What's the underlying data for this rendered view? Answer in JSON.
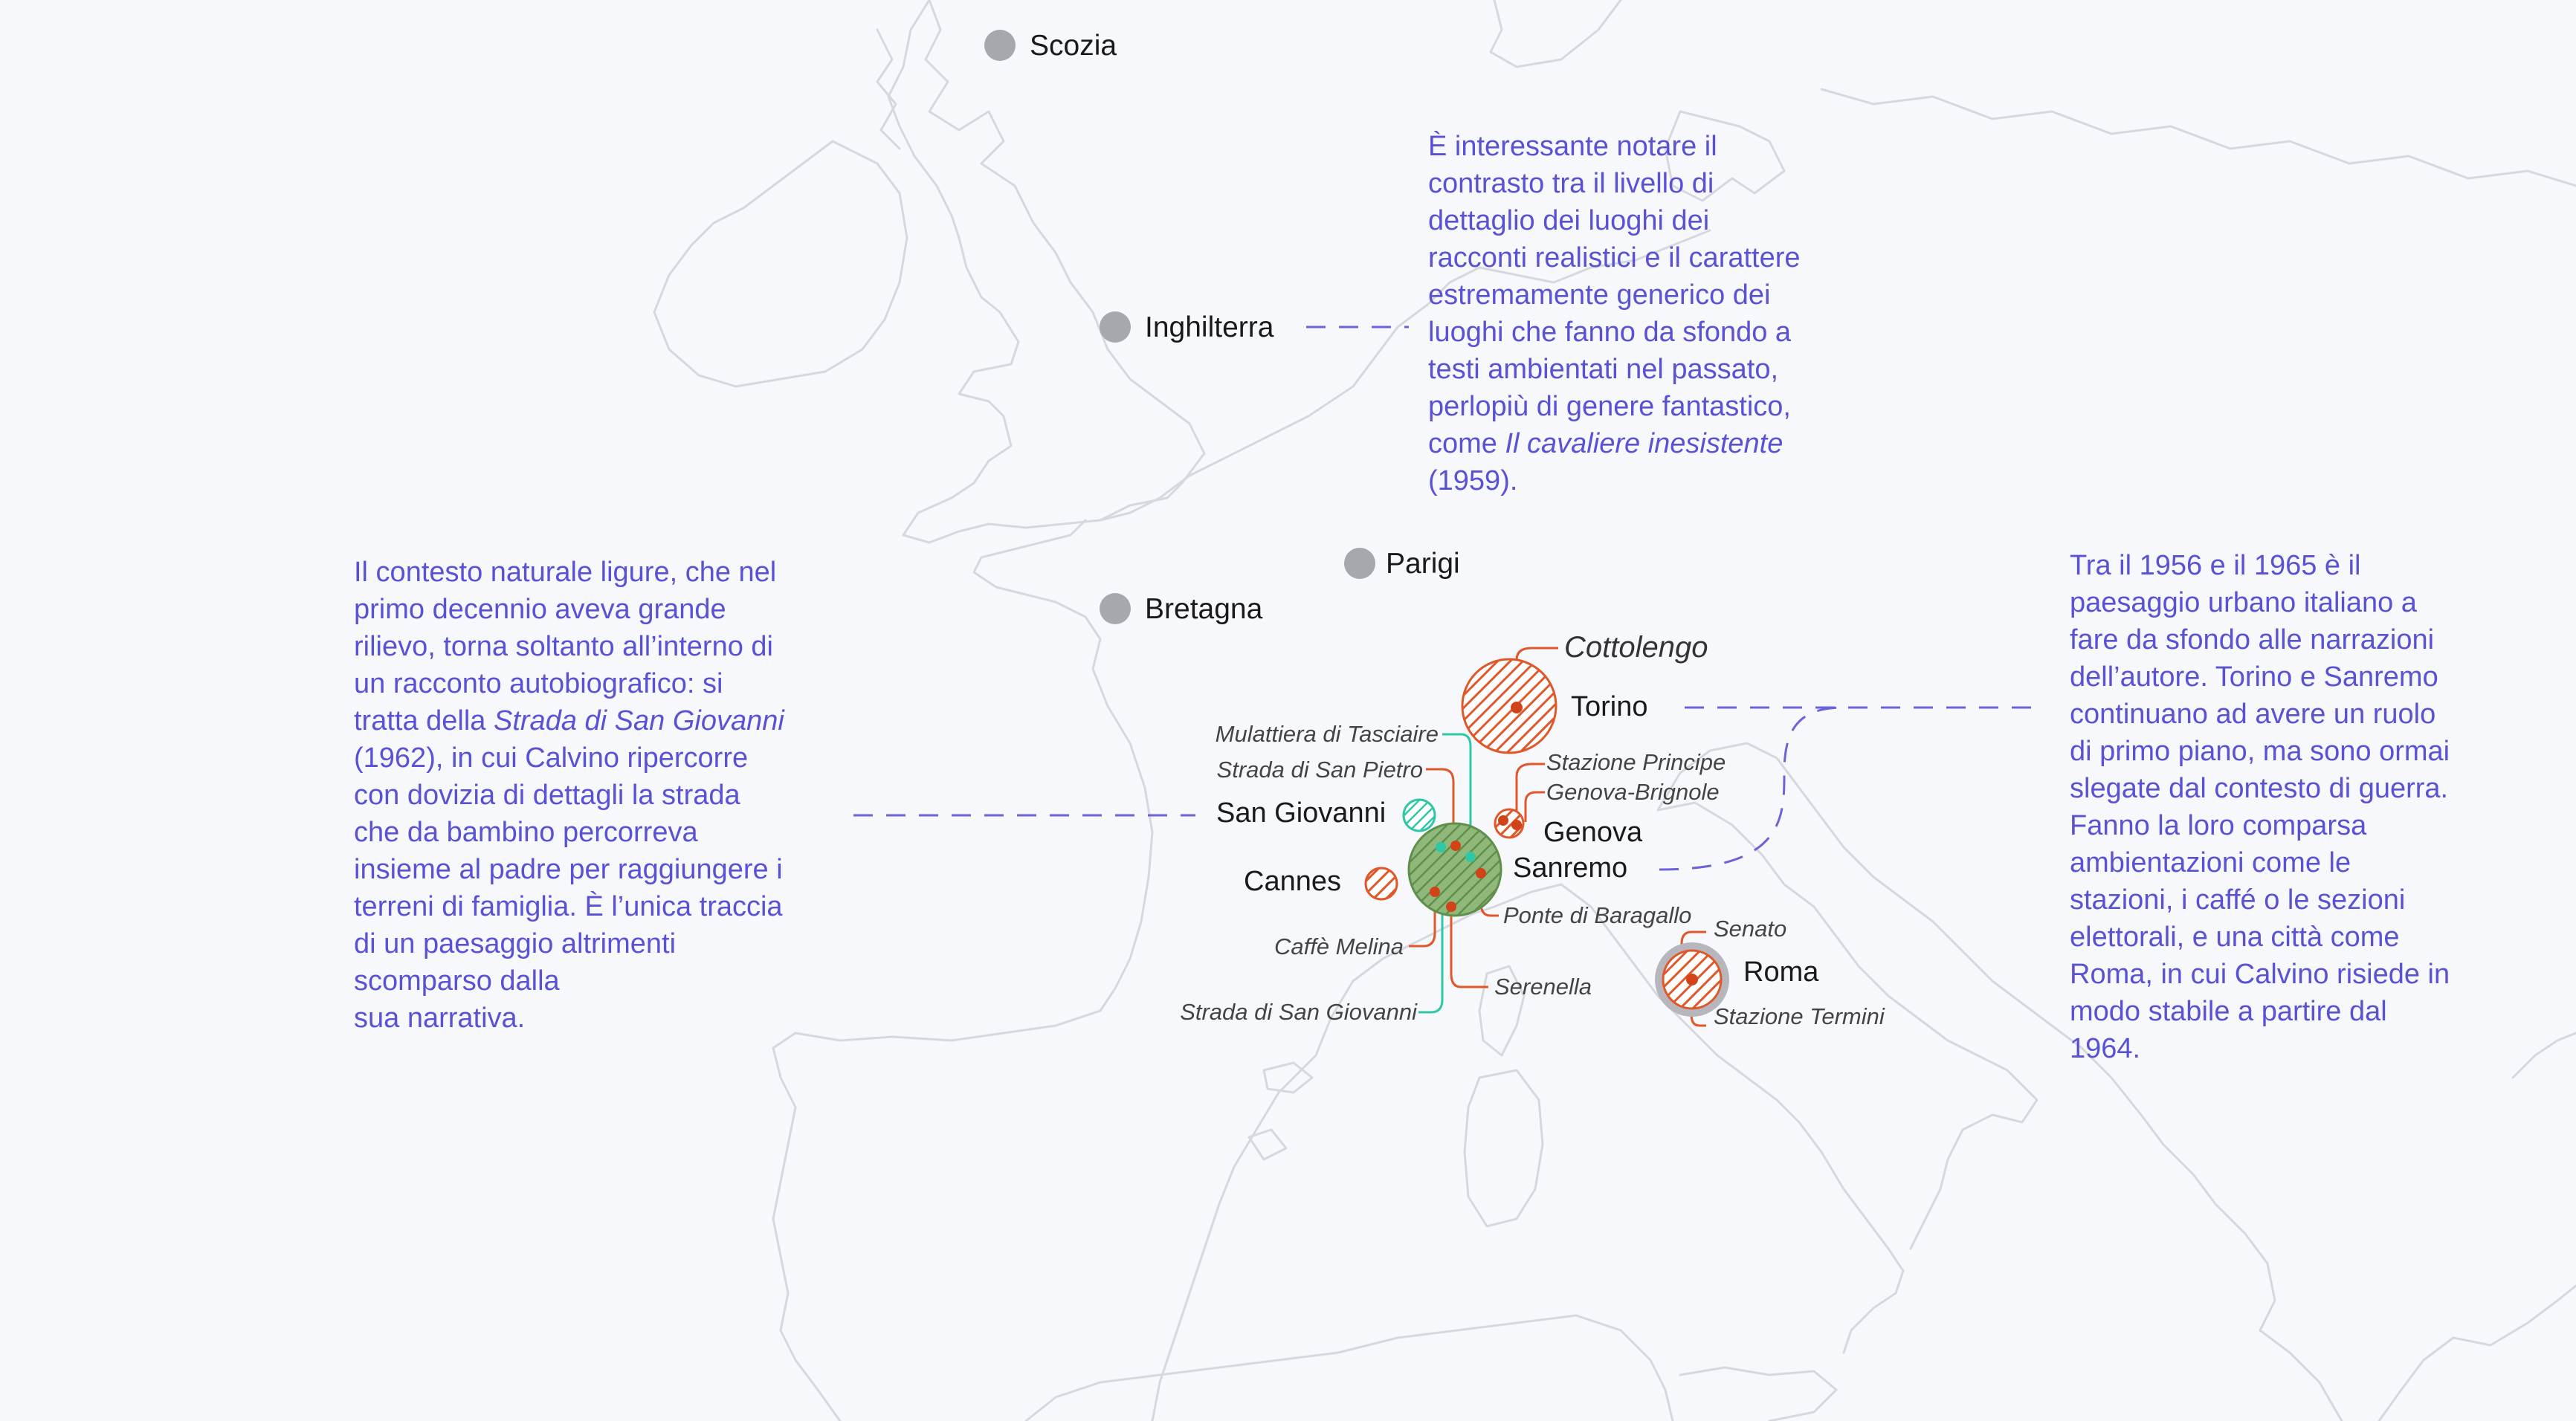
{
  "countries": {
    "scozia": "Scozia",
    "inghilterra": "Inghilterra",
    "bretagna": "Bretagna",
    "parigi": "Parigi"
  },
  "cities": {
    "torino": "Torino",
    "san_giovanni": "San Giovanni",
    "genova": "Genova",
    "sanremo": "Sanremo",
    "cannes": "Cannes",
    "roma": "Roma"
  },
  "places": {
    "cottolengo": "Cottolengo",
    "mulattiera": "Mulattiera di Tasciaire",
    "strada_san_pietro": "Strada di San Pietro",
    "stazione_principe": "Stazione Principe",
    "genova_brignole": "Genova-Brignole",
    "ponte_baragallo": "Ponte di Baragallo",
    "caffe_melina": "Caffè Melina",
    "serenella": "Serenella",
    "strada_san_giovanni": "Strada di San Giovanni",
    "senato": "Senato",
    "stazione_termini": "Stazione Termini"
  },
  "notes": {
    "top": {
      "p1": "È interessante notare il\ncontrasto tra il livello di\ndettaglio dei luoghi dei\nracconti realistici e il carattere\nestremamente generico dei\nluoghi che fanno da sfondo a\ntesti ambientati nel passato,\nperlopiù di genere fantastico,\ncome ",
      "title": "Il cavaliere inesistente",
      "p2": "\n(1959)."
    },
    "left": {
      "p1": "Il contesto naturale ligure, che nel\nprimo decennio aveva grande\nrilievo, torna soltanto all’interno di\nun racconto autobiografico: si\ntratta della ",
      "title": "Strada di San Giovanni",
      "p2": "\n(1962), in cui Calvino ripercorre\ncon dovizia di dettagli la strada\nche da bambino percorreva\ninsieme al padre per raggiungere i\nterreni di famiglia. È l’unica traccia\ndi un paesaggio altrimenti\nscomparso dalla\nsua narrativa."
    },
    "right": "Tra il 1956 e il 1965 è il\npaesaggio urbano italiano a\nfare da sfondo alle narrazioni\ndell’autore. Torino e Sanremo\ncontinuano ad avere un ruolo\ndi primo piano, ma sono ormai\nslegate dal contesto di guerra.\nFanno la loro comparsa\nambientazioni come le\nstazioni, i caffé o le sezioni\nelettorali, e una città come\nRoma, in cui Calvino risiede in\nmodo stabile a partire dal\n1964."
  },
  "colors": {
    "background": "#f7f8fc",
    "coastline": "#d6d8df",
    "note_text": "#5a52d5",
    "country_dot": "#a7a8ad",
    "orange": "#e0572a",
    "green": "#6f9e5a",
    "teal": "#2fc7a6",
    "roma_ring": "#b6b6bc"
  }
}
